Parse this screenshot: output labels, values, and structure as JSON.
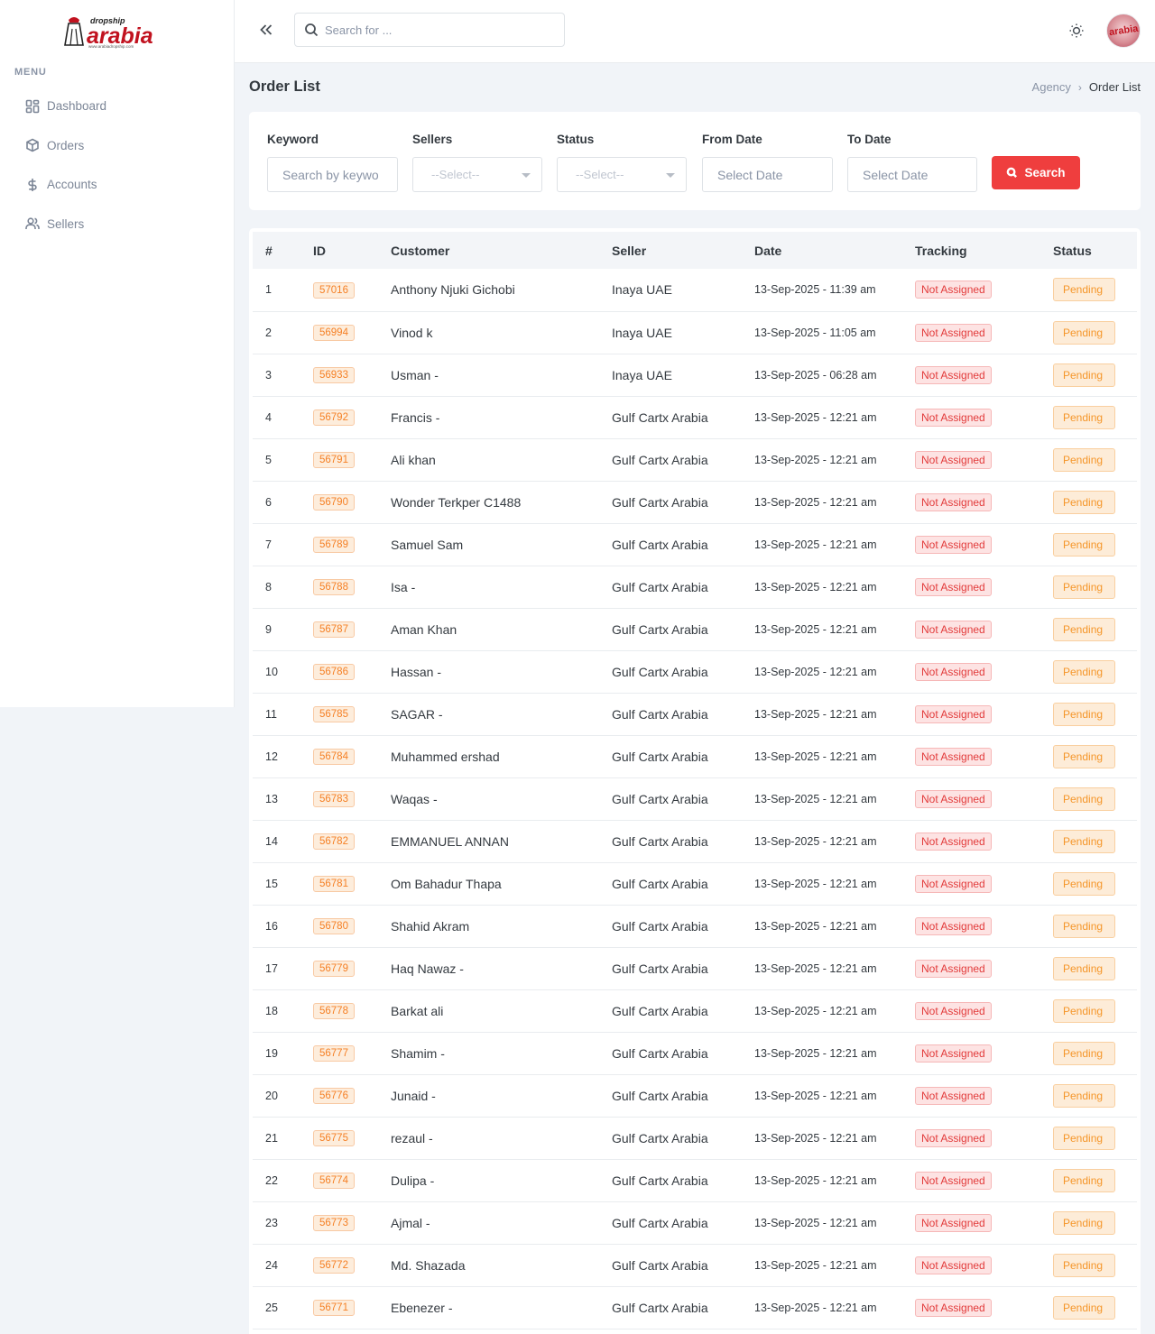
{
  "brand": {
    "name": "dropship arabia"
  },
  "sidebar": {
    "menu_title": "MENU",
    "items": [
      {
        "label": "Dashboard",
        "icon": "dashboard-icon"
      },
      {
        "label": "Orders",
        "icon": "box-icon"
      },
      {
        "label": "Accounts",
        "icon": "dollar-icon"
      },
      {
        "label": "Sellers",
        "icon": "users-icon"
      }
    ]
  },
  "topbar": {
    "search_placeholder": "Search for ...",
    "avatar_text": "arabia"
  },
  "page": {
    "title": "Order List",
    "breadcrumb": [
      "Agency",
      "Order List"
    ]
  },
  "filters": {
    "keyword_label": "Keyword",
    "keyword_placeholder": "Search by keywo",
    "sellers_label": "Sellers",
    "sellers_value": "--Select--",
    "status_label": "Status",
    "status_value": "--Select--",
    "from_label": "From Date",
    "from_placeholder": "Select Date",
    "to_label": "To Date",
    "to_placeholder": "Select Date",
    "search_button": "Search"
  },
  "table": {
    "headers": [
      "#",
      "ID",
      "Customer",
      "Seller",
      "Date",
      "Tracking",
      "Status"
    ],
    "rows": [
      {
        "n": "1",
        "id": "57016",
        "customer": "Anthony Njuki Gichobi",
        "seller": "Inaya UAE",
        "date": "13-Sep-2025 - 11:39 am",
        "tracking": "Not Assigned",
        "status": "Pending"
      },
      {
        "n": "2",
        "id": "56994",
        "customer": "Vinod k",
        "seller": "Inaya UAE",
        "date": "13-Sep-2025 - 11:05 am",
        "tracking": "Not Assigned",
        "status": "Pending"
      },
      {
        "n": "3",
        "id": "56933",
        "customer": "Usman -",
        "seller": "Inaya UAE",
        "date": "13-Sep-2025 - 06:28 am",
        "tracking": "Not Assigned",
        "status": "Pending"
      },
      {
        "n": "4",
        "id": "56792",
        "customer": "Francis -",
        "seller": "Gulf Cartx Arabia",
        "date": "13-Sep-2025 - 12:21 am",
        "tracking": "Not Assigned",
        "status": "Pending"
      },
      {
        "n": "5",
        "id": "56791",
        "customer": "Ali khan",
        "seller": "Gulf Cartx Arabia",
        "date": "13-Sep-2025 - 12:21 am",
        "tracking": "Not Assigned",
        "status": "Pending"
      },
      {
        "n": "6",
        "id": "56790",
        "customer": "Wonder Terkper C1488",
        "seller": "Gulf Cartx Arabia",
        "date": "13-Sep-2025 - 12:21 am",
        "tracking": "Not Assigned",
        "status": "Pending"
      },
      {
        "n": "7",
        "id": "56789",
        "customer": "Samuel Sam",
        "seller": "Gulf Cartx Arabia",
        "date": "13-Sep-2025 - 12:21 am",
        "tracking": "Not Assigned",
        "status": "Pending"
      },
      {
        "n": "8",
        "id": "56788",
        "customer": "Isa -",
        "seller": "Gulf Cartx Arabia",
        "date": "13-Sep-2025 - 12:21 am",
        "tracking": "Not Assigned",
        "status": "Pending"
      },
      {
        "n": "9",
        "id": "56787",
        "customer": "Aman Khan",
        "seller": "Gulf Cartx Arabia",
        "date": "13-Sep-2025 - 12:21 am",
        "tracking": "Not Assigned",
        "status": "Pending"
      },
      {
        "n": "10",
        "id": "56786",
        "customer": "Hassan -",
        "seller": "Gulf Cartx Arabia",
        "date": "13-Sep-2025 - 12:21 am",
        "tracking": "Not Assigned",
        "status": "Pending"
      },
      {
        "n": "11",
        "id": "56785",
        "customer": "SAGAR -",
        "seller": "Gulf Cartx Arabia",
        "date": "13-Sep-2025 - 12:21 am",
        "tracking": "Not Assigned",
        "status": "Pending"
      },
      {
        "n": "12",
        "id": "56784",
        "customer": "Muhammed ershad",
        "seller": "Gulf Cartx Arabia",
        "date": "13-Sep-2025 - 12:21 am",
        "tracking": "Not Assigned",
        "status": "Pending"
      },
      {
        "n": "13",
        "id": "56783",
        "customer": "Waqas -",
        "seller": "Gulf Cartx Arabia",
        "date": "13-Sep-2025 - 12:21 am",
        "tracking": "Not Assigned",
        "status": "Pending"
      },
      {
        "n": "14",
        "id": "56782",
        "customer": "EMMANUEL ANNAN",
        "seller": "Gulf Cartx Arabia",
        "date": "13-Sep-2025 - 12:21 am",
        "tracking": "Not Assigned",
        "status": "Pending"
      },
      {
        "n": "15",
        "id": "56781",
        "customer": "Om Bahadur Thapa",
        "seller": "Gulf Cartx Arabia",
        "date": "13-Sep-2025 - 12:21 am",
        "tracking": "Not Assigned",
        "status": "Pending"
      },
      {
        "n": "16",
        "id": "56780",
        "customer": "Shahid Akram",
        "seller": "Gulf Cartx Arabia",
        "date": "13-Sep-2025 - 12:21 am",
        "tracking": "Not Assigned",
        "status": "Pending"
      },
      {
        "n": "17",
        "id": "56779",
        "customer": "Haq Nawaz -",
        "seller": "Gulf Cartx Arabia",
        "date": "13-Sep-2025 - 12:21 am",
        "tracking": "Not Assigned",
        "status": "Pending"
      },
      {
        "n": "18",
        "id": "56778",
        "customer": "Barkat ali",
        "seller": "Gulf Cartx Arabia",
        "date": "13-Sep-2025 - 12:21 am",
        "tracking": "Not Assigned",
        "status": "Pending"
      },
      {
        "n": "19",
        "id": "56777",
        "customer": "Shamim -",
        "seller": "Gulf Cartx Arabia",
        "date": "13-Sep-2025 - 12:21 am",
        "tracking": "Not Assigned",
        "status": "Pending"
      },
      {
        "n": "20",
        "id": "56776",
        "customer": "Junaid -",
        "seller": "Gulf Cartx Arabia",
        "date": "13-Sep-2025 - 12:21 am",
        "tracking": "Not Assigned",
        "status": "Pending"
      },
      {
        "n": "21",
        "id": "56775",
        "customer": "rezaul -",
        "seller": "Gulf Cartx Arabia",
        "date": "13-Sep-2025 - 12:21 am",
        "tracking": "Not Assigned",
        "status": "Pending"
      },
      {
        "n": "22",
        "id": "56774",
        "customer": "Dulipa -",
        "seller": "Gulf Cartx Arabia",
        "date": "13-Sep-2025 - 12:21 am",
        "tracking": "Not Assigned",
        "status": "Pending"
      },
      {
        "n": "23",
        "id": "56773",
        "customer": "Ajmal -",
        "seller": "Gulf Cartx Arabia",
        "date": "13-Sep-2025 - 12:21 am",
        "tracking": "Not Assigned",
        "status": "Pending"
      },
      {
        "n": "24",
        "id": "56772",
        "customer": "Md. Shazada",
        "seller": "Gulf Cartx Arabia",
        "date": "13-Sep-2025 - 12:21 am",
        "tracking": "Not Assigned",
        "status": "Pending"
      },
      {
        "n": "25",
        "id": "56771",
        "customer": "Ebenezer -",
        "seller": "Gulf Cartx Arabia",
        "date": "13-Sep-2025 - 12:21 am",
        "tracking": "Not Assigned",
        "status": "Pending"
      }
    ]
  },
  "colors": {
    "accent_red": "#ef3e3e",
    "id_orange": "#f58025",
    "pending_orange": "#f5962a",
    "not_assigned_red": "#e23b3b"
  }
}
